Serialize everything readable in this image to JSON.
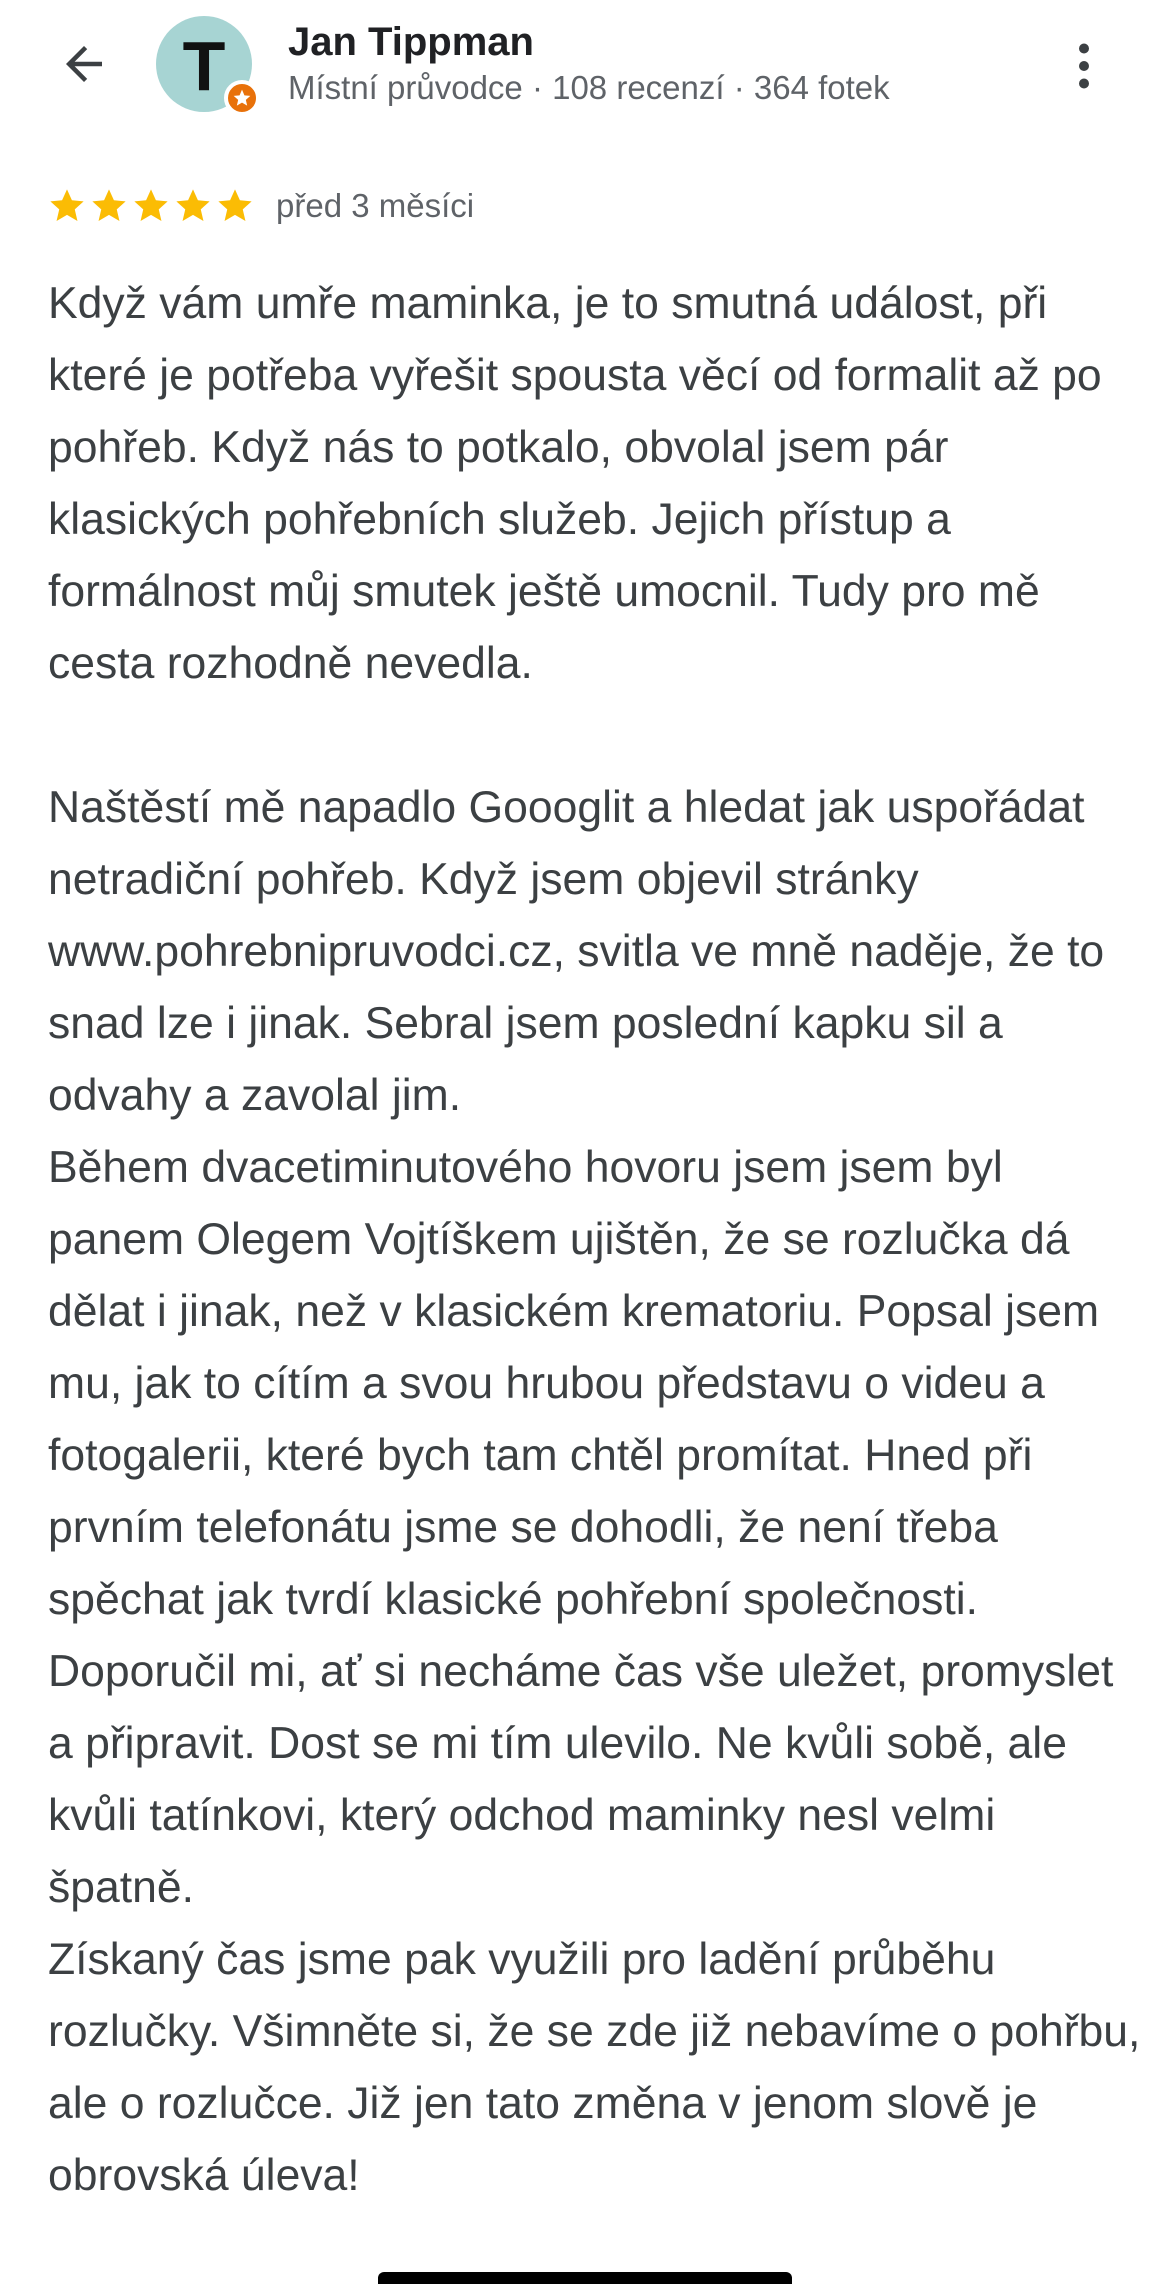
{
  "header": {
    "back_icon": "arrow-left-icon",
    "avatar": {
      "letter": "T",
      "background": "#a7d4d3",
      "badge_icon": "local-guide-star-icon",
      "badge_color": "#e8710a"
    },
    "user_name": "Jan Tippman",
    "user_meta": "Místní průvodce · 108 recenzí · 364 fotek",
    "more_icon": "more-vertical-icon"
  },
  "review": {
    "rating": 5,
    "max_rating": 5,
    "star_color": "#fbbc04",
    "date": "před 3 měsíci",
    "paragraphs": [
      "Když vám umře maminka, je to smutná událost, při které je potřeba vyřešit spousta věcí od formalit až po pohřeb. Když nás to potkalo, obvolal jsem pár klasických pohřebních služeb. Jejich přístup a formálnost můj smutek ještě umocnil. Tudy pro mě cesta rozhodně nevedla.",
      "Naštěstí mě napadlo Goooglit a hledat jak uspořádat netradiční pohřeb. Když jsem objevil stránky www.pohrebnipruvodci.cz, svitla ve mně naděje, že to snad lze i jinak. Sebral jsem poslední kapku sil a odvahy a zavolal jim.\nBěhem dvacetiminutového hovoru jsem jsem byl panem Olegem Vojtíškem ujištěn, že se rozlučka dá dělat i jinak, než v klasickém krematoriu. Popsal jsem mu, jak to cítím a svou hrubou představu o videu a fotogalerii, které bych tam chtěl promítat. Hned při prvním telefonátu jsme se dohodli, že není třeba spěchat jak tvrdí klasické pohřební společnosti. Doporučil mi, ať si necháme čas vše uležet, promyslet a připravit. Dost se mi tím ulevilo. Ne kvůli sobě, ale kvůli tatínkovi, který odchod maminky nesl velmi špatně.\nZískaný čas jsme pak využili pro ladění průběhu rozlučky. Všimněte si, že se zde již nebavíme o pohřbu, ale o rozlučce. Již jen tato změna v jenom slově je obrovská úleva!"
    ]
  }
}
